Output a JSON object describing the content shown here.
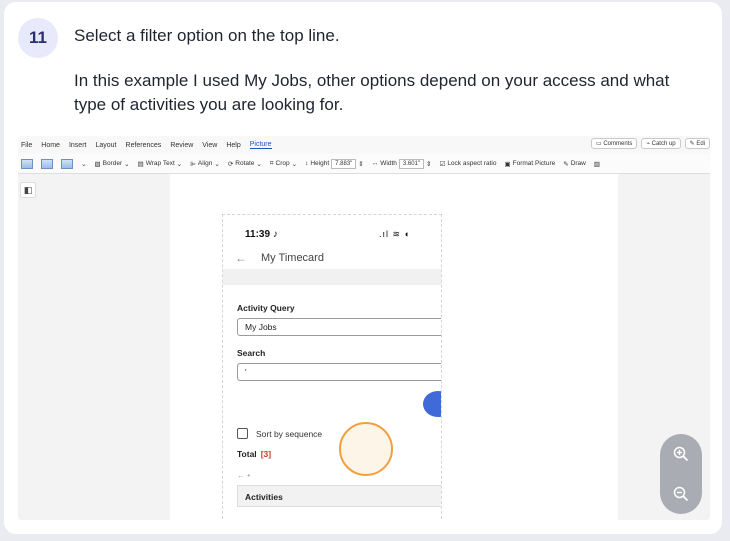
{
  "step": {
    "number": "11",
    "title": "Select a filter option on the top line.",
    "description": "In this example I used My Jobs, other options depend on your access and what type of activities you are looking for."
  },
  "word": {
    "menu": [
      "File",
      "Home",
      "Insert",
      "Layout",
      "References",
      "Review",
      "View",
      "Help",
      "Picture"
    ],
    "active_menu": "Picture",
    "comments": "Comments",
    "catch_up": "Catch up",
    "edit": "Edi",
    "toolbar": {
      "border": "Border",
      "wrap_text": "Wrap Text",
      "align": "Align",
      "rotate": "Rotate",
      "crop": "Crop",
      "height_label": "Height",
      "height_value": "7.883\"",
      "width_label": "Width",
      "width_value": "3.601\"",
      "lock_aspect": "Lock aspect ratio",
      "format_picture": "Format Picture",
      "draw": "Draw"
    }
  },
  "phone": {
    "time": "11:39",
    "title": "My Timecard",
    "activity_query_label": "Activity Query",
    "activity_query_value": "My Jobs",
    "search_label": "Search",
    "search_value": "'",
    "sort_label": "Sort by sequence",
    "total_label": "Total",
    "total_count": "[3]",
    "activities_header": "Activities"
  },
  "colors": {
    "highlight": "#f0a040",
    "badge_bg": "#e8e9fb",
    "accent_blue": "#3f6ad8",
    "count_red": "#c0392b"
  },
  "icons": {
    "zoom_in": "zoom-in-icon",
    "zoom_out": "zoom-out-icon"
  }
}
